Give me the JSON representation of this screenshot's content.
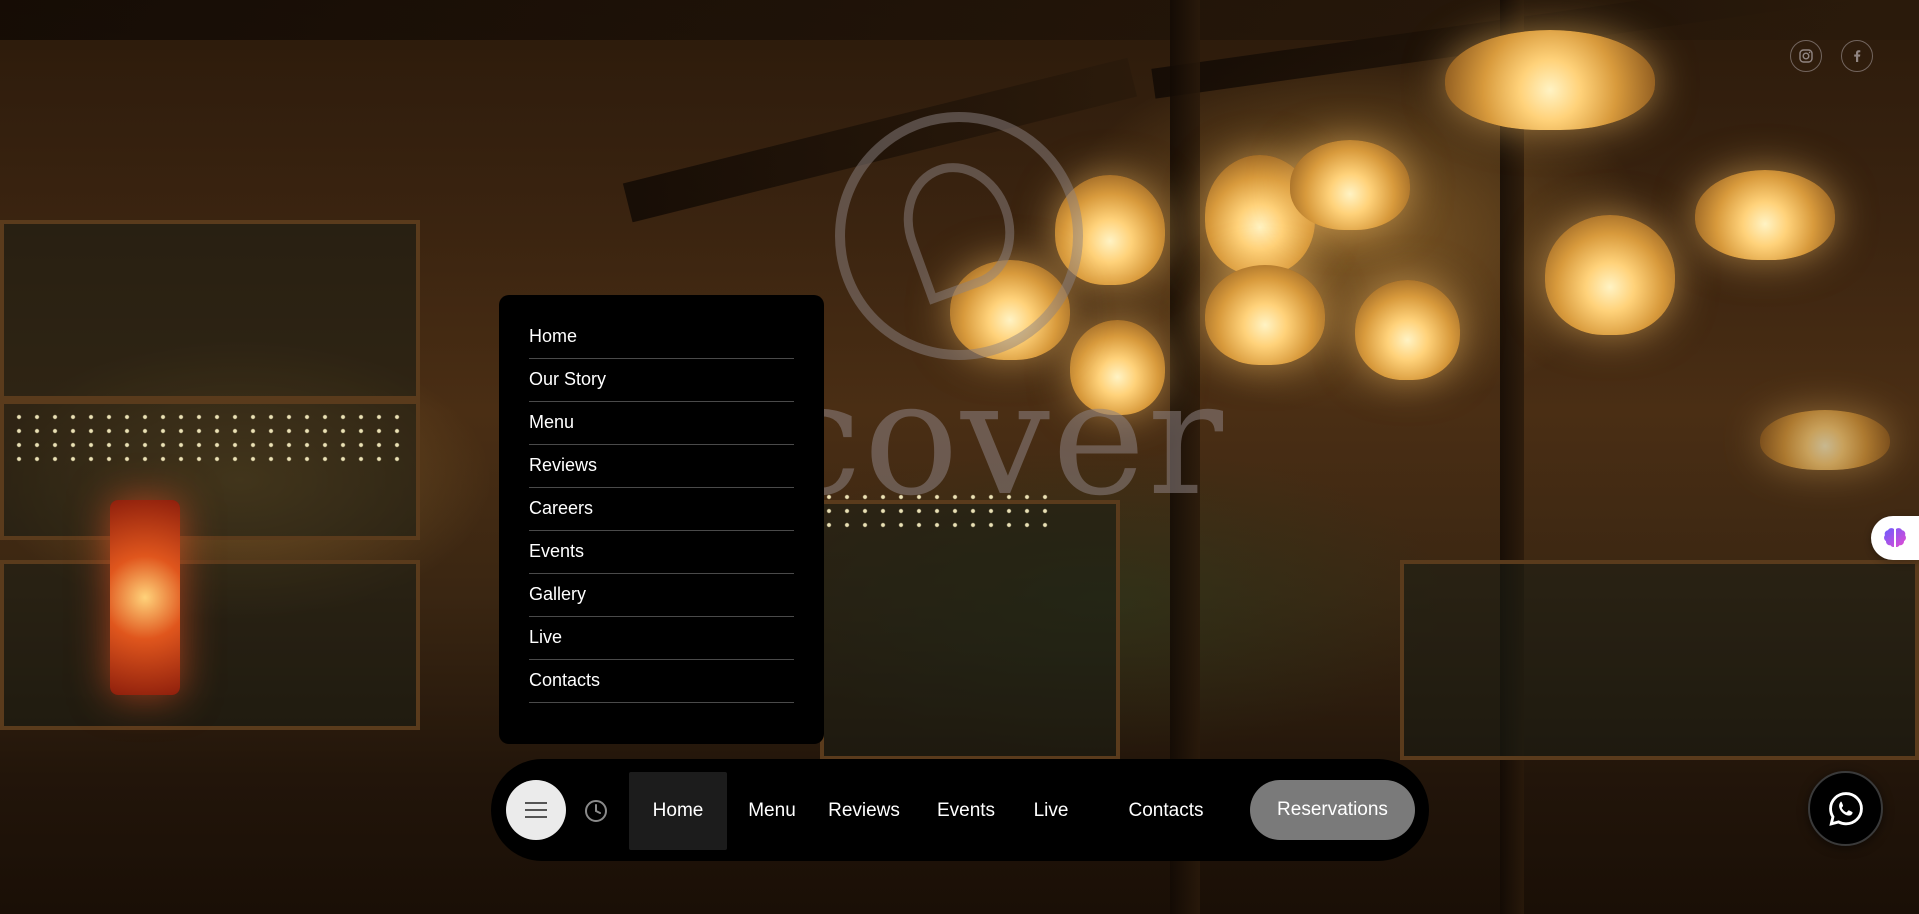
{
  "brand": {
    "wordmark": "scover"
  },
  "social": [
    {
      "name": "instagram-icon"
    },
    {
      "name": "facebook-icon"
    }
  ],
  "dropdown_menu": {
    "items": [
      {
        "label": "Home"
      },
      {
        "label": "Our Story"
      },
      {
        "label": "Menu"
      },
      {
        "label": "Reviews"
      },
      {
        "label": "Careers"
      },
      {
        "label": "Events"
      },
      {
        "label": "Gallery"
      },
      {
        "label": "Live"
      },
      {
        "label": "Contacts"
      }
    ]
  },
  "navbar": {
    "links": [
      {
        "label": "Home",
        "active": true
      },
      {
        "label": "Menu"
      },
      {
        "label": "Reviews"
      },
      {
        "label": "Events"
      },
      {
        "label": "Live"
      },
      {
        "label": "Contacts"
      }
    ],
    "reservations_label": "Reservations"
  },
  "colors": {
    "panel": "#000000",
    "reservations_button": "#7a7a7a",
    "hamburger_button": "#ebebeb",
    "active_link_bg": "#1c1c1c"
  }
}
